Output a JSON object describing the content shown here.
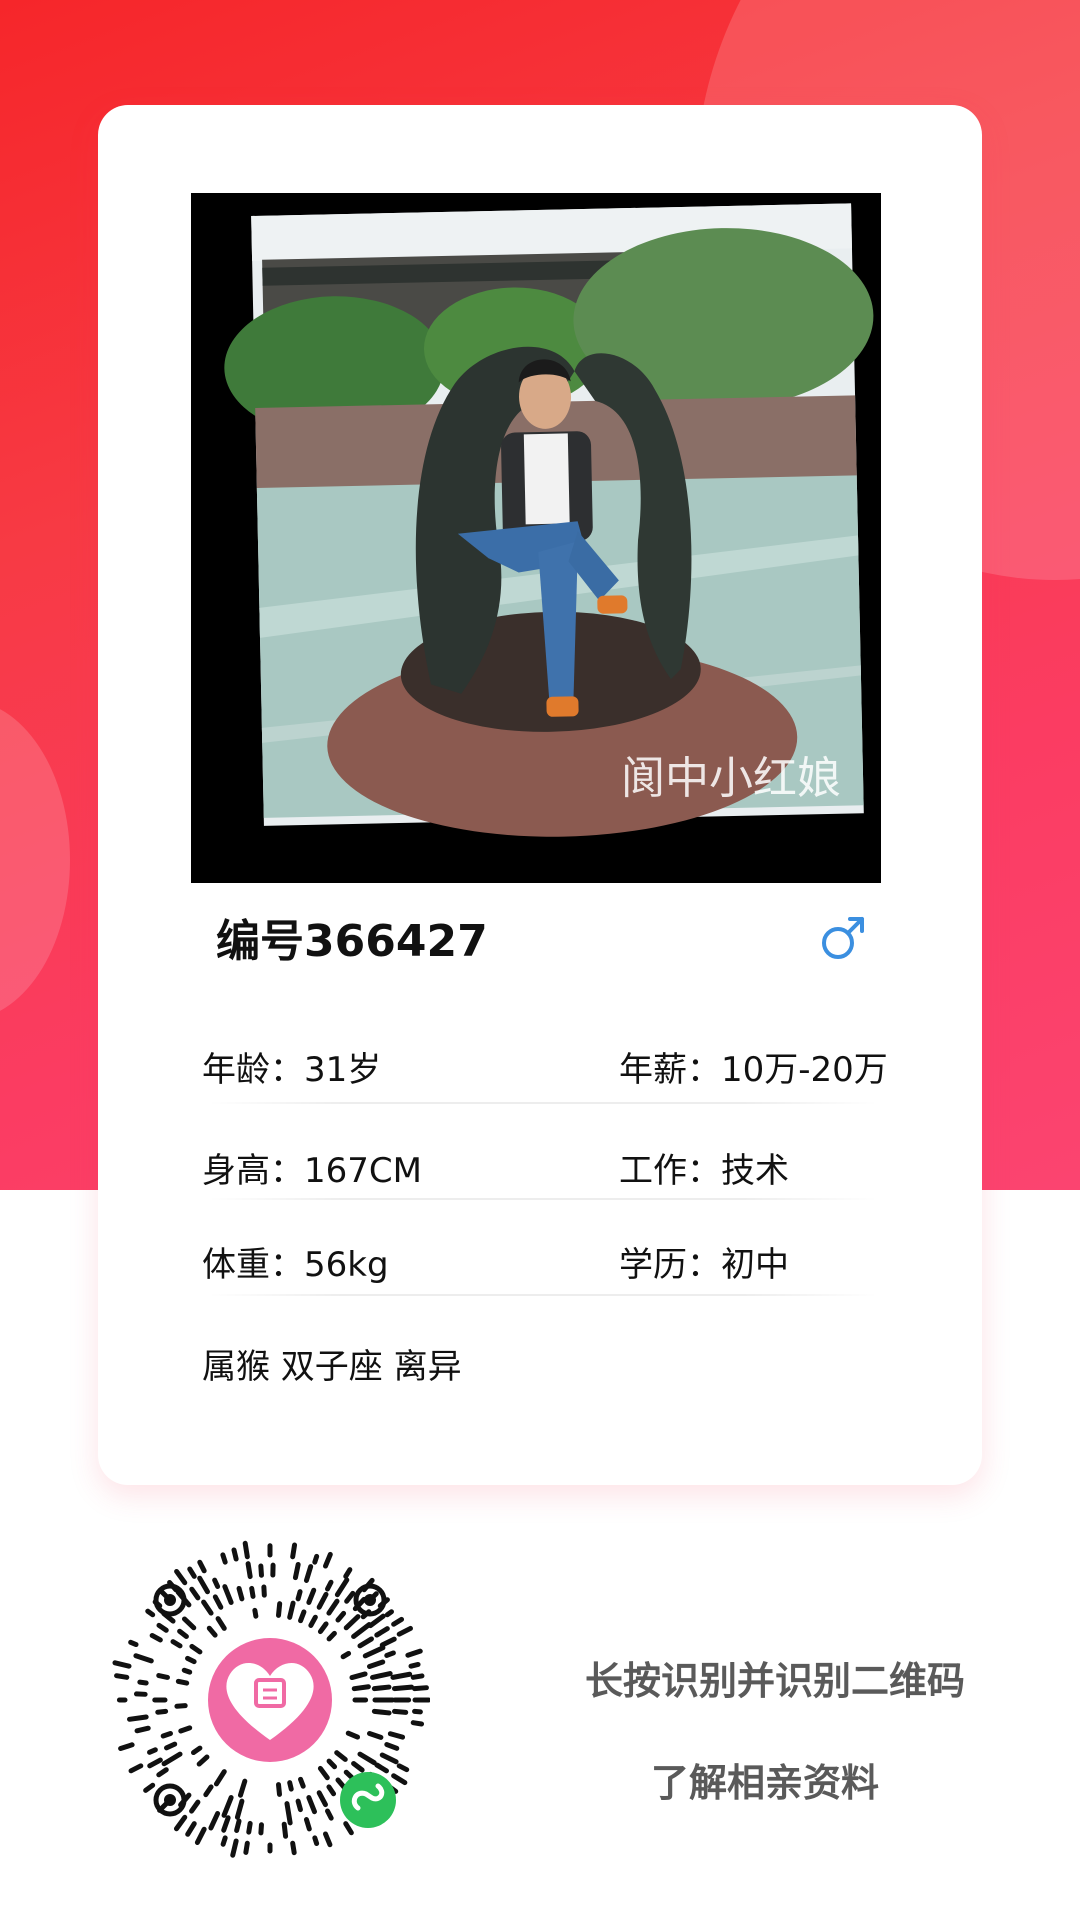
{
  "profile": {
    "id_label": "编号366427",
    "gender": "male",
    "photo_watermark": "阆中小红娘",
    "age": "年龄：31岁",
    "salary": "年薪：10万-20万",
    "height": "身高：167CM",
    "job": "工作：技术",
    "weight": "体重：56kg",
    "education": "学历：初中",
    "tags": "属猴 双子座 离异"
  },
  "footer": {
    "qr_center_logo_icon": "heart-logo-icon",
    "qr_badge_icon": "mini-program-icon",
    "line1": "长按识别并识别二维码",
    "line2": "了解相亲资料"
  },
  "colors": {
    "primary_red": "#f6262a",
    "pink": "#fb4470",
    "male_blue": "#3b8fe0",
    "qr_logo_pink": "#f06aa4",
    "badge_green": "#2dc05a"
  }
}
